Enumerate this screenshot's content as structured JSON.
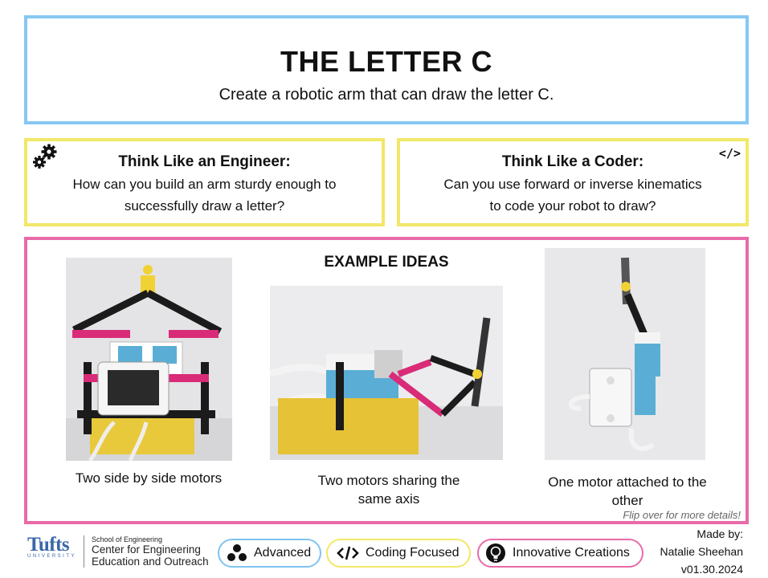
{
  "header": {
    "title": "THE LETTER C",
    "subtitle": "Create a robotic arm that can draw the letter C."
  },
  "engineer": {
    "title": "Think Like an Engineer:",
    "line1": "How can you build an arm sturdy enough to",
    "line2": "successfully draw a letter?",
    "icon": "gears-icon"
  },
  "coder": {
    "title": "Think Like a Coder:",
    "line1": "Can you use forward or inverse kinematics",
    "line2": "to code your robot to draw?",
    "icon": "code-icon",
    "icon_glyph": "</>"
  },
  "ideas": {
    "title": "EXAMPLE IDEAS",
    "items": [
      {
        "caption_line1": "Two side by side motors",
        "caption_line2": ""
      },
      {
        "caption_line1": "Two motors sharing the",
        "caption_line2": "same axis"
      },
      {
        "caption_line1": "One motor attached to the",
        "caption_line2": "other"
      }
    ],
    "flip_note": "Flip over for more details!"
  },
  "footer": {
    "tufts": "Tufts",
    "university": "UNIVERSITY",
    "school": "School of Engineering",
    "center_line1": "Center for Engineering",
    "center_line2": "Education and Outreach",
    "badges": [
      {
        "label": "Advanced",
        "icon": "dots-icon",
        "color": "#7fc4ef"
      },
      {
        "label": "Coding Focused",
        "icon": "code-icon",
        "color": "#f2e768"
      },
      {
        "label": "Innovative Creations",
        "icon": "lightbulb-icon",
        "color": "#e96aa8"
      }
    ],
    "made_by": "Made by:",
    "author": "Natalie Sheehan",
    "version": "v01.30.2024"
  },
  "colors": {
    "title_border": "#86c8f2",
    "card_border": "#f2e768",
    "ideas_border": "#e96aa8",
    "tufts_blue": "#3a67a8"
  }
}
